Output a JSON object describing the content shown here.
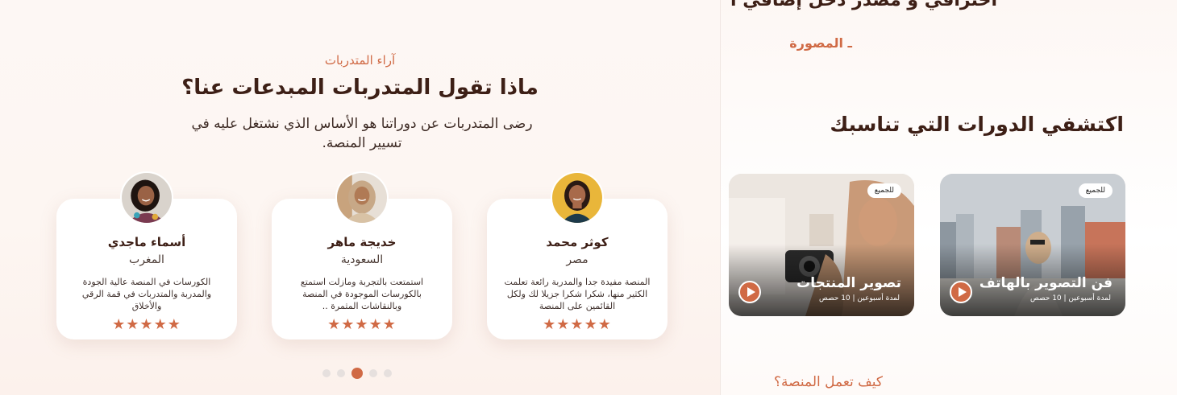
{
  "testimonials": {
    "eyebrow": "آراء المتدربات",
    "title": "ماذا تقول المتدربات المبدعات عنا؟",
    "subtitle": "رضى المتدربات عن دوراتنا هو الأساس الذي نشتغل عليه في تسيير المنصة.",
    "cards": [
      {
        "name": "كوثر محمد",
        "country": "مصر",
        "text": "المنصة مفيدة جدا والمدربة رائعة تعلمت الكثير منها، شكرا شكرا جزيلا لك ولكل القائمين على المنصة",
        "rating": 5,
        "stars": "★★★★★",
        "avatar_icon": "woman-portrait-yellow-bg"
      },
      {
        "name": "خديجة ماهر",
        "country": "السعودية",
        "text": "استمتعت بالتجربة ومازلت استمتع بالكورسات الموجودة في المنصة وبالنقاشات المثمرة ..",
        "rating": 5,
        "stars": "★★★★★",
        "avatar_icon": "woman-portrait-hijab"
      },
      {
        "name": "أسماء ماجدي",
        "country": "المغرب",
        "text": "الكورسات في المنصة عالية الجودة والمدربة والمتدربات في قمة الرقي والأخلاق",
        "rating": 5,
        "stars": "★★★★★",
        "avatar_icon": "woman-portrait-smiling"
      }
    ],
    "pagination": {
      "total": 5,
      "active_index": 2
    }
  },
  "right": {
    "cut_heading": "احترافي و مصدر دخل إضافي ا",
    "eyebrow": "ـ المصورة",
    "section_title": "اكتشفي الدورات التي تناسبك",
    "courses": [
      {
        "badge": "للجميع",
        "title": "فن التصوير بالهاتف",
        "meta": "لمدة أسبوعين | 10 حصص",
        "play_icon": "play-icon"
      },
      {
        "badge": "للجميع",
        "title": "تصوير المنتجات",
        "meta": "لمدة أسبوعين | 10 حصص",
        "play_icon": "play-icon"
      }
    ],
    "how_link": "كيف تعمل المنصة؟"
  },
  "colors": {
    "accent": "#d06a45",
    "title_text": "#3d1f16",
    "panel_bg": "#fdf7f4"
  }
}
